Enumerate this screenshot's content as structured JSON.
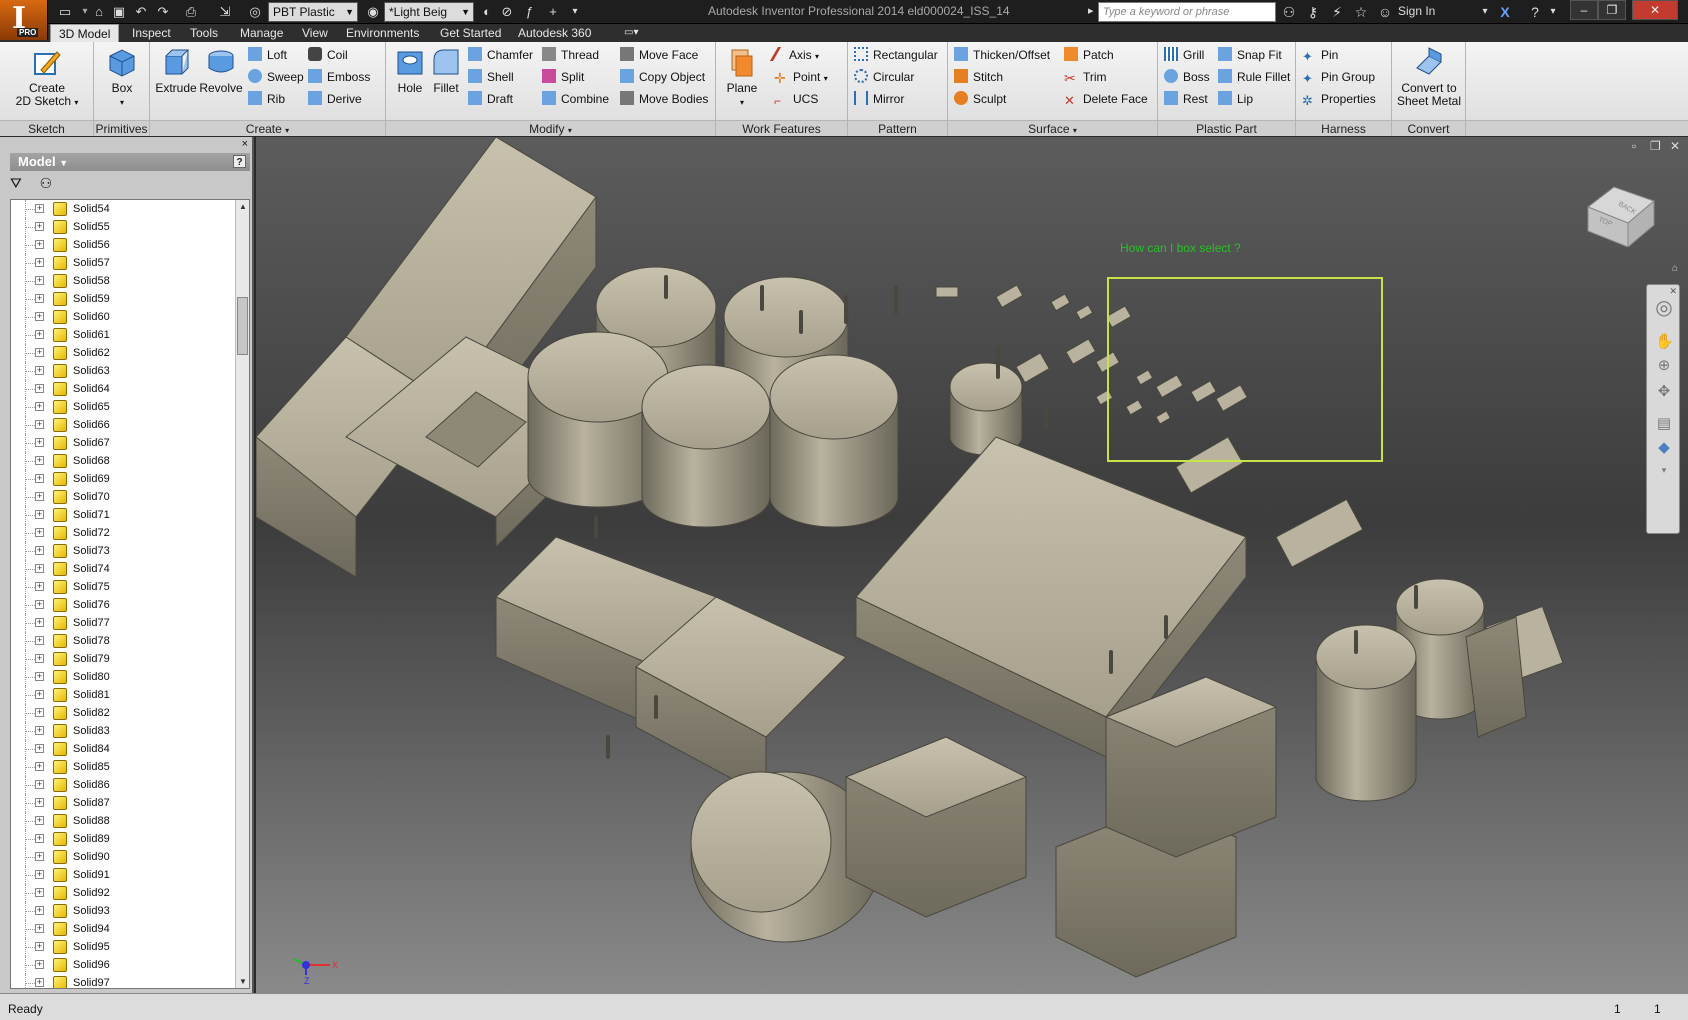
{
  "window": {
    "title": "Autodesk Inventor Professional 2014    eld000024_ISS_14",
    "logo_letter": "I",
    "logo_edition": "PRO",
    "search_placeholder": "Type a keyword or phrase",
    "signin_label": "Sign In"
  },
  "quick_access": {
    "material": "PBT Plastic",
    "appearance": "*Light Beig"
  },
  "tabs": [
    "3D Model",
    "Inspect",
    "Tools",
    "Manage",
    "View",
    "Environments",
    "Get Started",
    "Autodesk 360"
  ],
  "active_tab": "3D Model",
  "ribbon": {
    "sketch": {
      "title": "Sketch",
      "create_label_1": "Create",
      "create_label_2": "2D Sketch"
    },
    "primitives": {
      "title": "Primitives",
      "box_label": "Box"
    },
    "create": {
      "title": "Create",
      "extrude": "Extrude",
      "revolve": "Revolve",
      "loft": "Loft",
      "sweep": "Sweep",
      "rib": "Rib",
      "coil": "Coil",
      "emboss": "Emboss",
      "derive": "Derive"
    },
    "modify": {
      "title": "Modify",
      "hole": "Hole",
      "fillet": "Fillet",
      "chamfer": "Chamfer",
      "shell": "Shell",
      "draft": "Draft",
      "thread": "Thread",
      "split": "Split",
      "combine": "Combine",
      "move_face": "Move Face",
      "copy_object": "Copy Object",
      "move_bodies": "Move Bodies"
    },
    "work_features": {
      "title": "Work Features",
      "plane": "Plane",
      "axis": "Axis",
      "point": "Point",
      "ucs": "UCS"
    },
    "pattern": {
      "title": "Pattern",
      "rectangular": "Rectangular",
      "circular": "Circular",
      "mirror": "Mirror"
    },
    "surface": {
      "title": "Surface",
      "thicken": "Thicken/Offset",
      "stitch": "Stitch",
      "sculpt": "Sculpt",
      "patch": "Patch",
      "trim": "Trim",
      "delete_face": "Delete Face"
    },
    "plastic_part": {
      "title": "Plastic Part",
      "grill": "Grill",
      "boss": "Boss",
      "rest": "Rest",
      "snap_fit": "Snap Fit",
      "rule_fillet": "Rule Fillet",
      "lip": "Lip"
    },
    "harness": {
      "title": "Harness",
      "pin": "Pin",
      "pin_group": "Pin Group",
      "properties": "Properties"
    },
    "convert": {
      "title": "Convert",
      "label_1": "Convert to",
      "label_2": "Sheet Metal"
    }
  },
  "browser": {
    "header": "Model",
    "help": "?",
    "close": "×",
    "items": [
      "Solid54",
      "Solid55",
      "Solid56",
      "Solid57",
      "Solid58",
      "Solid59",
      "Solid60",
      "Solid61",
      "Solid62",
      "Solid63",
      "Solid64",
      "Solid65",
      "Solid66",
      "Solid67",
      "Solid68",
      "Solid69",
      "Solid70",
      "Solid71",
      "Solid72",
      "Solid73",
      "Solid74",
      "Solid75",
      "Solid76",
      "Solid77",
      "Solid78",
      "Solid79",
      "Solid80",
      "Solid81",
      "Solid82",
      "Solid83",
      "Solid84",
      "Solid85",
      "Solid86",
      "Solid87",
      "Solid88",
      "Solid89",
      "Solid90",
      "Solid91",
      "Solid92",
      "Solid93",
      "Solid94",
      "Solid95",
      "Solid96",
      "Solid97"
    ]
  },
  "viewport": {
    "annotation": "How can I box select ?",
    "viewcube_back": "BACK",
    "viewcube_top": "TOP",
    "axis_x": "X",
    "axis_z": "Z"
  },
  "status": {
    "text": "Ready",
    "num1": "1",
    "num2": "1"
  },
  "colors": {
    "selection_box": "#c6e34a",
    "annotation": "#28c028",
    "model": "#a39d8c"
  }
}
